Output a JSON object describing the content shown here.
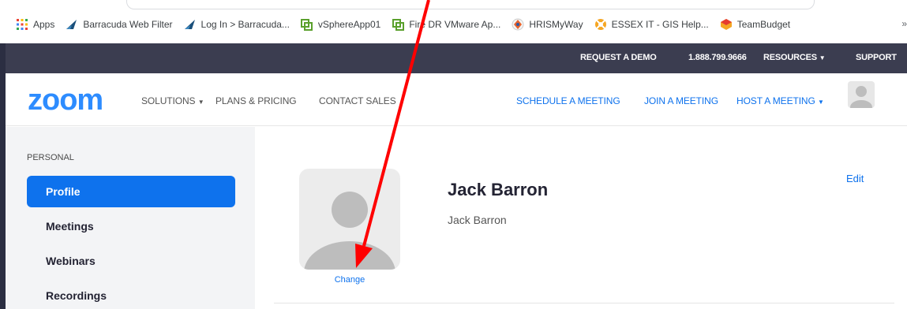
{
  "bookmarks": {
    "items": [
      {
        "label": "Apps",
        "icon": "apps-grid-icon"
      },
      {
        "label": "Barracuda Web Filter",
        "icon": "barracuda-icon"
      },
      {
        "label": "Log In > Barracuda...",
        "icon": "barracuda-icon"
      },
      {
        "label": "vSphereApp01",
        "icon": "vsphere-icon"
      },
      {
        "label": "Fire DR VMware Ap...",
        "icon": "vsphere-icon"
      },
      {
        "label": "HRISMyWay",
        "icon": "hris-icon"
      },
      {
        "label": "ESSEX IT - GIS Help...",
        "icon": "lifebuoy-icon"
      },
      {
        "label": "TeamBudget",
        "icon": "teambudget-icon"
      }
    ],
    "more": "»"
  },
  "topnav": {
    "request_demo": "REQUEST A DEMO",
    "phone": "1.888.799.9666",
    "resources": "RESOURCES",
    "support": "SUPPORT"
  },
  "header": {
    "logo": "zoom",
    "solutions": "SOLUTIONS",
    "plans": "PLANS & PRICING",
    "contact": "CONTACT SALES",
    "schedule": "SCHEDULE A MEETING",
    "join": "JOIN A MEETING",
    "host": "HOST A MEETING"
  },
  "sidebar": {
    "heading": "PERSONAL",
    "items": [
      {
        "label": "Profile",
        "active": true
      },
      {
        "label": "Meetings"
      },
      {
        "label": "Webinars"
      },
      {
        "label": "Recordings"
      }
    ]
  },
  "profile": {
    "name": "Jack Barron",
    "display_name": "Jack Barron",
    "change_label": "Change",
    "edit_label": "Edit"
  },
  "colors": {
    "brand_blue": "#0e72ed",
    "logo_blue": "#2d8cff",
    "topnav_bg": "#3b3d50",
    "annotation_red": "#ff0000"
  }
}
